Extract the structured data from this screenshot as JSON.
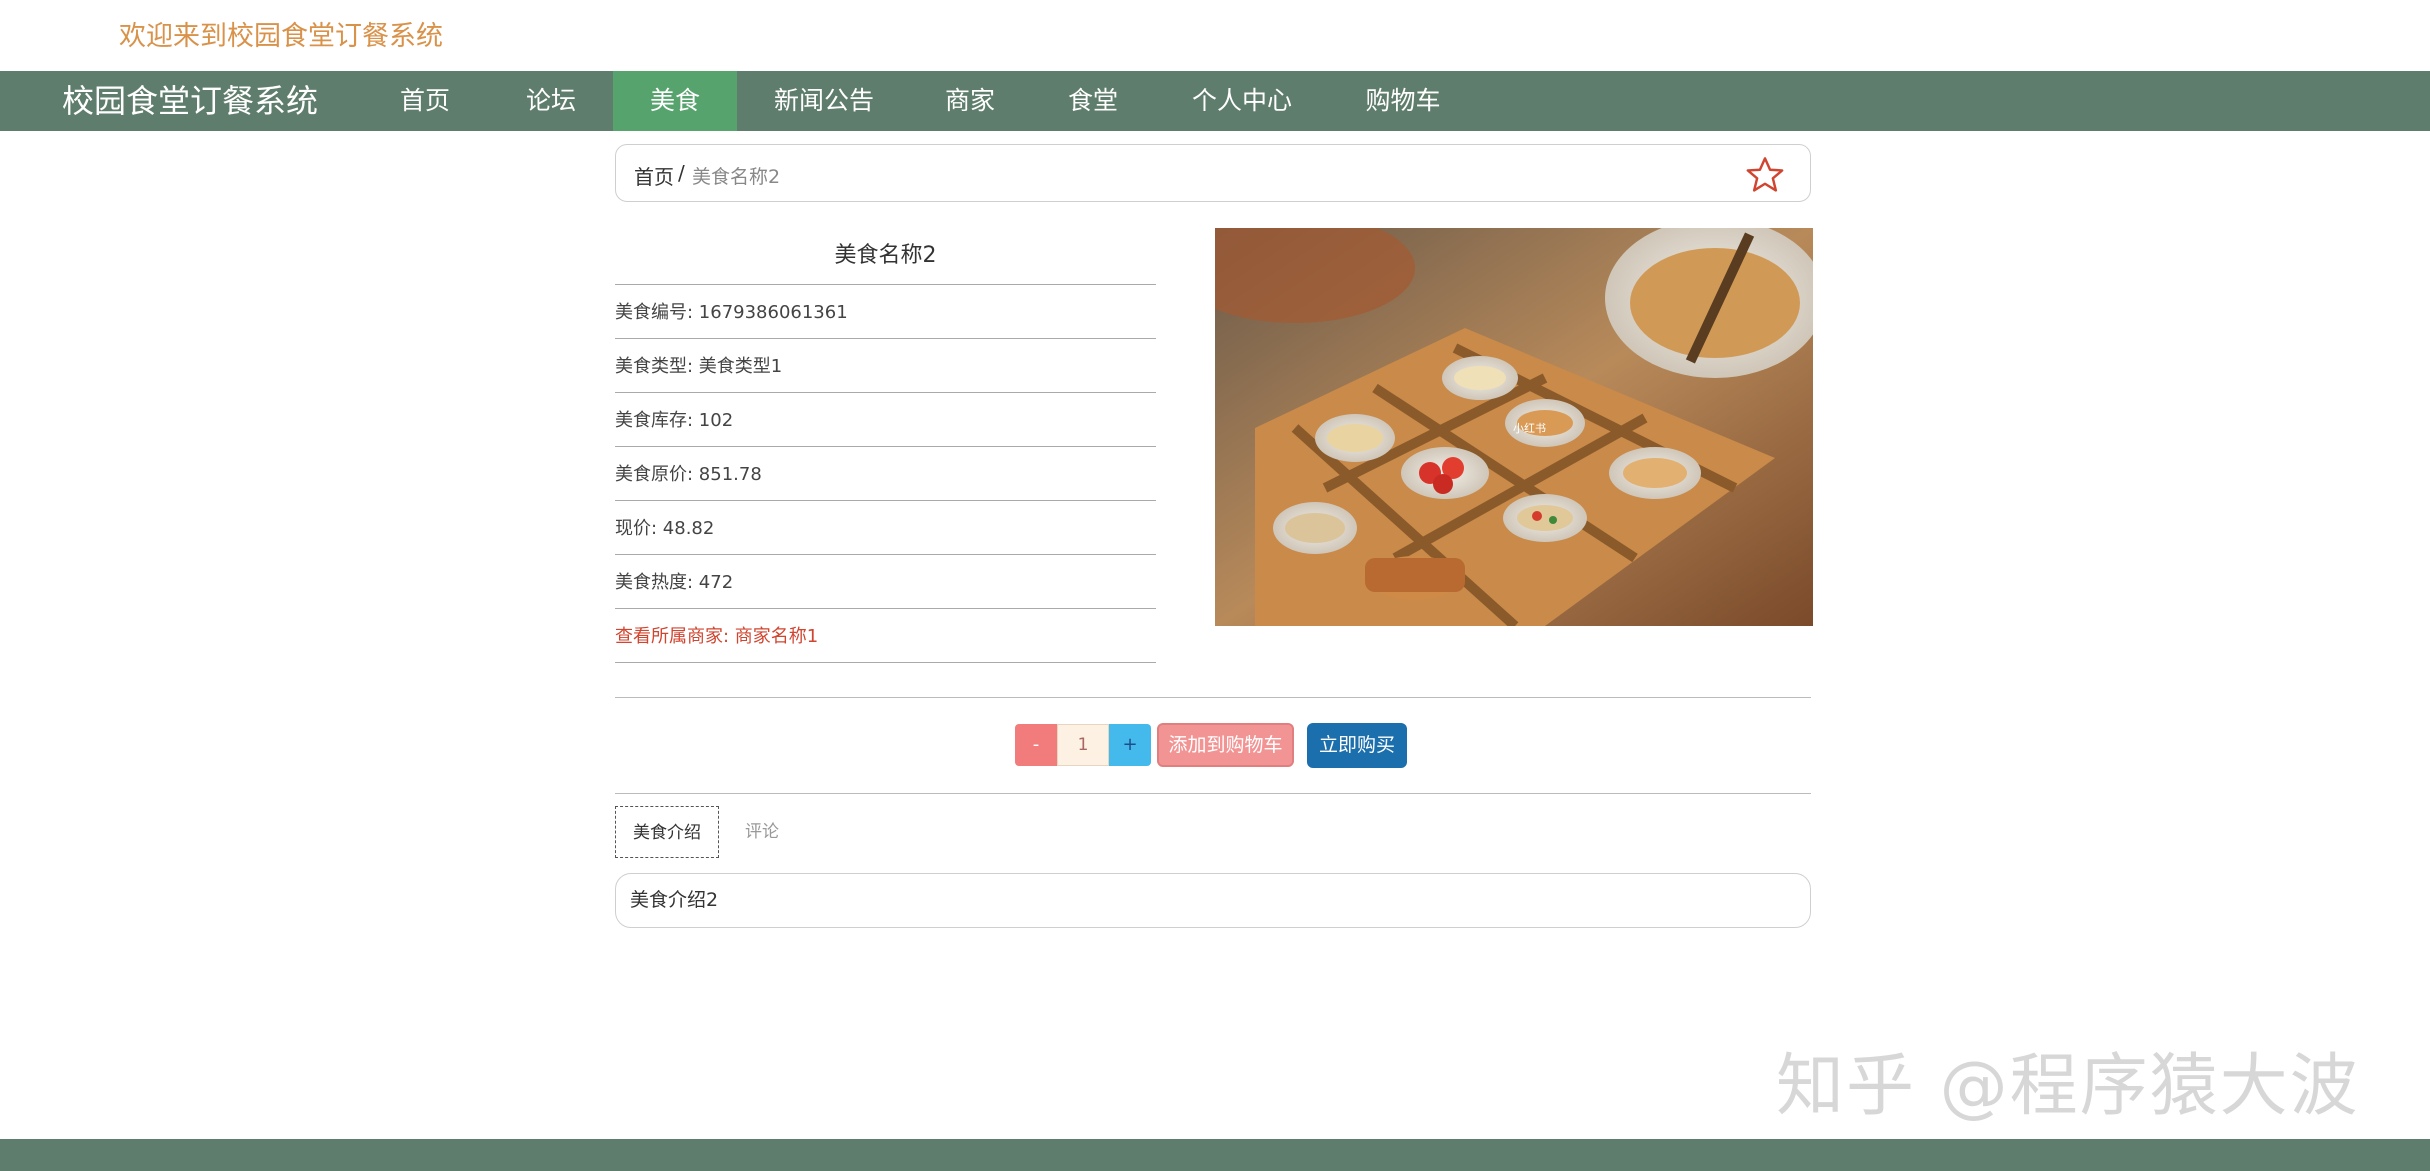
{
  "header": {
    "welcome": "欢迎来到校园食堂订餐系统",
    "brand": "校园食堂订餐系统"
  },
  "nav": {
    "items": [
      {
        "label": "首页"
      },
      {
        "label": "论坛"
      },
      {
        "label": "美食"
      },
      {
        "label": "新闻公告"
      },
      {
        "label": "商家"
      },
      {
        "label": "食堂"
      },
      {
        "label": "个人中心"
      },
      {
        "label": "购物车"
      }
    ],
    "active": "美食"
  },
  "breadcrumb": {
    "home": "首页",
    "separator": "/",
    "current": "美食名称2"
  },
  "food": {
    "name": "美食名称2",
    "fields": [
      {
        "text": "美食编号: 1679386061361"
      },
      {
        "text": "美食类型: 美食类型1"
      },
      {
        "text": "美食库存: 102"
      },
      {
        "text": "美食原价: 851.78"
      },
      {
        "text": "现价: 48.82"
      },
      {
        "text": "美食热度: 472"
      }
    ],
    "merchant_link": "查看所属商家: 商家名称1",
    "image_alt_icon": "food-photo",
    "image_caption": "小红书"
  },
  "purchase": {
    "minus": "-",
    "quantity": "1",
    "plus": "+",
    "add_to_cart": "添加到购物车",
    "buy_now": "立即购买"
  },
  "tabs": [
    {
      "label": "美食介绍"
    },
    {
      "label": "评论"
    }
  ],
  "intro_text": "美食介绍2",
  "watermark": "知乎 @程序猿大波",
  "colors": {
    "nav_bg": "#5f7d6c",
    "nav_active": "#57a36d",
    "welcome_text": "#d9924a",
    "merchant_link": "#d0452f",
    "buy_now": "#1c6fad",
    "add_to_cart": "#f39494"
  }
}
